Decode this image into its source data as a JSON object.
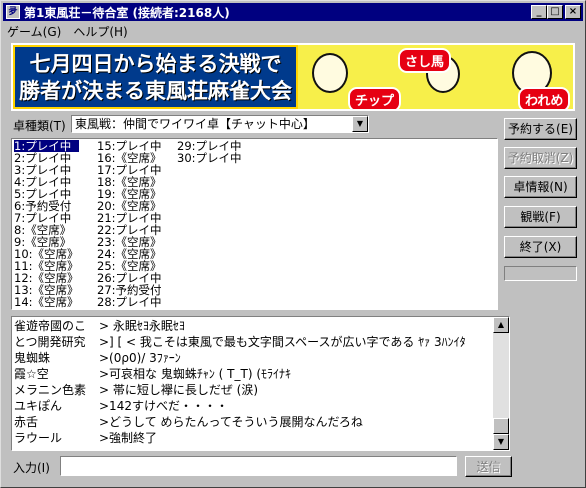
{
  "window": {
    "title": "第1東風荘－待合室 (接続者:2168人)",
    "icon_glyph": "夛",
    "minimize": "_",
    "maximize": "□",
    "close": "×"
  },
  "menu": [
    "ゲーム(G)",
    "ヘルプ(H)"
  ],
  "banner": {
    "line1": "七月四日から始まる決戦で",
    "line2": "勝者が決まる東風荘麻雀大会",
    "tags": [
      "さし馬",
      "チップ",
      "われめ"
    ]
  },
  "table_type": {
    "label": "卓種類(T)",
    "selected": "東風戦：仲間でワイワイ卓【チャット中心】",
    "arrow": "▼"
  },
  "buttons": {
    "reserve": "予約する(E)",
    "cancel_reserve": "予約取消(Z)",
    "table_info": "卓情報(N)",
    "watch": "観戦(F)",
    "exit": "終了(X)",
    "send": "送信"
  },
  "tables": {
    "col1": [
      " 1:プレイ中",
      " 2:プレイ中",
      " 3:プレイ中",
      " 4:プレイ中",
      " 5:プレイ中",
      " 6:予約受付",
      " 7:プレイ中",
      " 8:《空席》",
      " 9:《空席》",
      "10:《空席》",
      "11:《空席》",
      "12:《空席》",
      "13:《空席》",
      "14:《空席》"
    ],
    "col2": [
      "15:プレイ中",
      "16:《空席》",
      "17:プレイ中",
      "18:《空席》",
      "19:《空席》",
      "20:《空席》",
      "21:プレイ中",
      "22:プレイ中",
      "23:《空席》",
      "24:《空席》",
      "25:《空席》",
      "26:プレイ中",
      "27:予約受付",
      "28:プレイ中"
    ],
    "col3": [
      "29:プレイ中",
      "30:プレイ中"
    ]
  },
  "chat": [
    {
      "name": "雀遊帝國のこ",
      "msg": ">                  永眠ｾﾖ永眠ｾﾖ"
    },
    {
      "name": "とつ開発研究",
      "msg": ">] [ < 我こそは東風で最も文字間スペースが広い字である ﾔｧ 3ﾊﾝｲﾀ"
    },
    {
      "name": "鬼蜘蛛",
      "msg": ">(0ρ0)/  3ﾌｧｰﾝ"
    },
    {
      "name": "霞☆空",
      "msg": ">可哀相な 鬼蜘蛛ﾁｬﾝ  (  T_T)  (ﾓﾗｲﾅｷ"
    },
    {
      "name": "メラニン色素",
      "msg": ">             帯に短し襷に長しだぜ (涙)"
    },
    {
      "name": "ユキぽん",
      "msg": ">142すけべだ・・・・"
    },
    {
      "name": "赤舌",
      "msg": ">どうして  めらたんってそういう展開なんだろね"
    },
    {
      "name": "ラウール",
      "msg": ">強制終了"
    }
  ],
  "scroll": {
    "up": "▲",
    "down": "▼"
  },
  "input": {
    "label": "入力(I)",
    "value": ""
  }
}
